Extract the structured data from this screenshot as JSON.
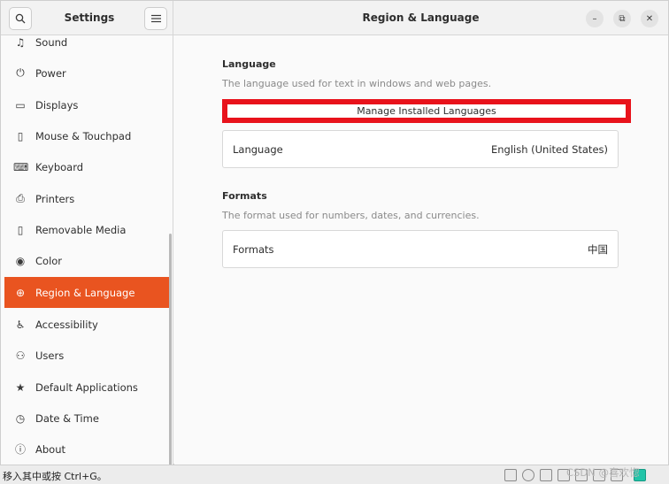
{
  "sidebar_header": {
    "title": "Settings",
    "search_icon": "search-icon",
    "menu_icon": "hamburger-menu-icon"
  },
  "panel_header": {
    "title": "Region & Language"
  },
  "window_controls": {
    "minimize": "–",
    "maximize": "⧉",
    "close": "✕"
  },
  "sidebar": {
    "items": [
      {
        "label": "Sound",
        "icon": "♫",
        "icon_name": "music-note-icon"
      },
      {
        "label": "Power",
        "icon": "⏻",
        "icon_name": "power-icon"
      },
      {
        "label": "Displays",
        "icon": "▭",
        "icon_name": "display-icon"
      },
      {
        "label": "Mouse & Touchpad",
        "icon": "▯",
        "icon_name": "mouse-icon"
      },
      {
        "label": "Keyboard",
        "icon": "⌨",
        "icon_name": "keyboard-icon"
      },
      {
        "label": "Printers",
        "icon": "⎙",
        "icon_name": "printer-icon"
      },
      {
        "label": "Removable Media",
        "icon": "▯",
        "icon_name": "removable-media-icon"
      },
      {
        "label": "Color",
        "icon": "◉",
        "icon_name": "color-icon"
      },
      {
        "label": "Region & Language",
        "icon": "⊕",
        "icon_name": "globe-icon",
        "active": true
      },
      {
        "label": "Accessibility",
        "icon": "♿",
        "icon_name": "accessibility-icon"
      },
      {
        "label": "Users",
        "icon": "⚇",
        "icon_name": "users-icon"
      },
      {
        "label": "Default Applications",
        "icon": "★",
        "icon_name": "star-icon"
      },
      {
        "label": "Date & Time",
        "icon": "◷",
        "icon_name": "clock-icon"
      },
      {
        "label": "About",
        "icon": "ⓘ",
        "icon_name": "info-icon"
      }
    ]
  },
  "language_section": {
    "title": "Language",
    "description": "The language used for text in windows and web pages.",
    "manage_button": "Manage Installed Languages",
    "row_label": "Language",
    "row_value": "English (United States)"
  },
  "formats_section": {
    "title": "Formats",
    "description": "The format used for numbers, dates, and currencies.",
    "row_label": "Formats",
    "row_value": "中国"
  },
  "statusbar": {
    "text": "移入其中或按 Ctrl+G。",
    "watermark": "CSDN @喜欢惚"
  },
  "colors": {
    "accent": "#e95420",
    "highlight_border": "#e8121b"
  }
}
